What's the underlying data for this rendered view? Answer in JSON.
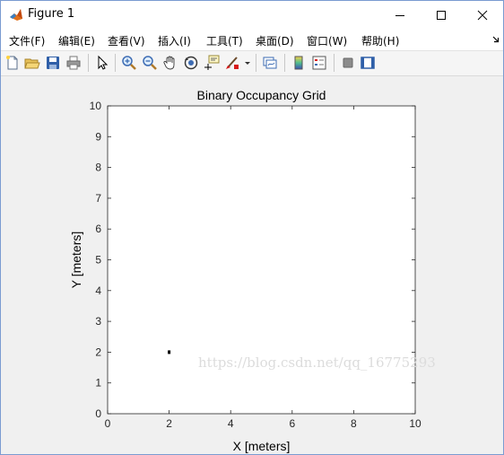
{
  "window": {
    "title": "Figure 1"
  },
  "menu": [
    {
      "label": "文件(F)"
    },
    {
      "label": "编辑(E)"
    },
    {
      "label": "查看(V)"
    },
    {
      "label": "插入(I)"
    },
    {
      "label": "工具(T)"
    },
    {
      "label": "桌面(D)"
    },
    {
      "label": "窗口(W)"
    },
    {
      "label": "帮助(H)"
    }
  ],
  "toolbar": {
    "icons": [
      "new-figure-icon",
      "open-file-icon",
      "save-icon",
      "print-icon",
      "pointer-icon",
      "zoom-in-icon",
      "zoom-out-icon",
      "pan-icon",
      "rotate-3d-icon",
      "data-cursor-icon",
      "brush-icon",
      "link-plot-icon",
      "colorbar-icon",
      "legend-icon",
      "hide-plot-tools-icon",
      "show-plot-tools-icon"
    ]
  },
  "chart_data": {
    "type": "scatter",
    "title": "Binary Occupancy Grid",
    "xlabel": "X [meters]",
    "ylabel": "Y [meters]",
    "xlim": [
      0,
      10
    ],
    "ylim": [
      0,
      10
    ],
    "xticks": [
      0,
      2,
      4,
      6,
      8,
      10
    ],
    "yticks": [
      0,
      1,
      2,
      3,
      4,
      5,
      6,
      7,
      8,
      9,
      10
    ],
    "grid": false,
    "occupied_cells": [
      {
        "x": 2.0,
        "y": 2.0
      }
    ],
    "marker_color": "#000000",
    "background_color": "#ffffff"
  },
  "watermark": "https://blog.csdn.net/qq_16775293"
}
